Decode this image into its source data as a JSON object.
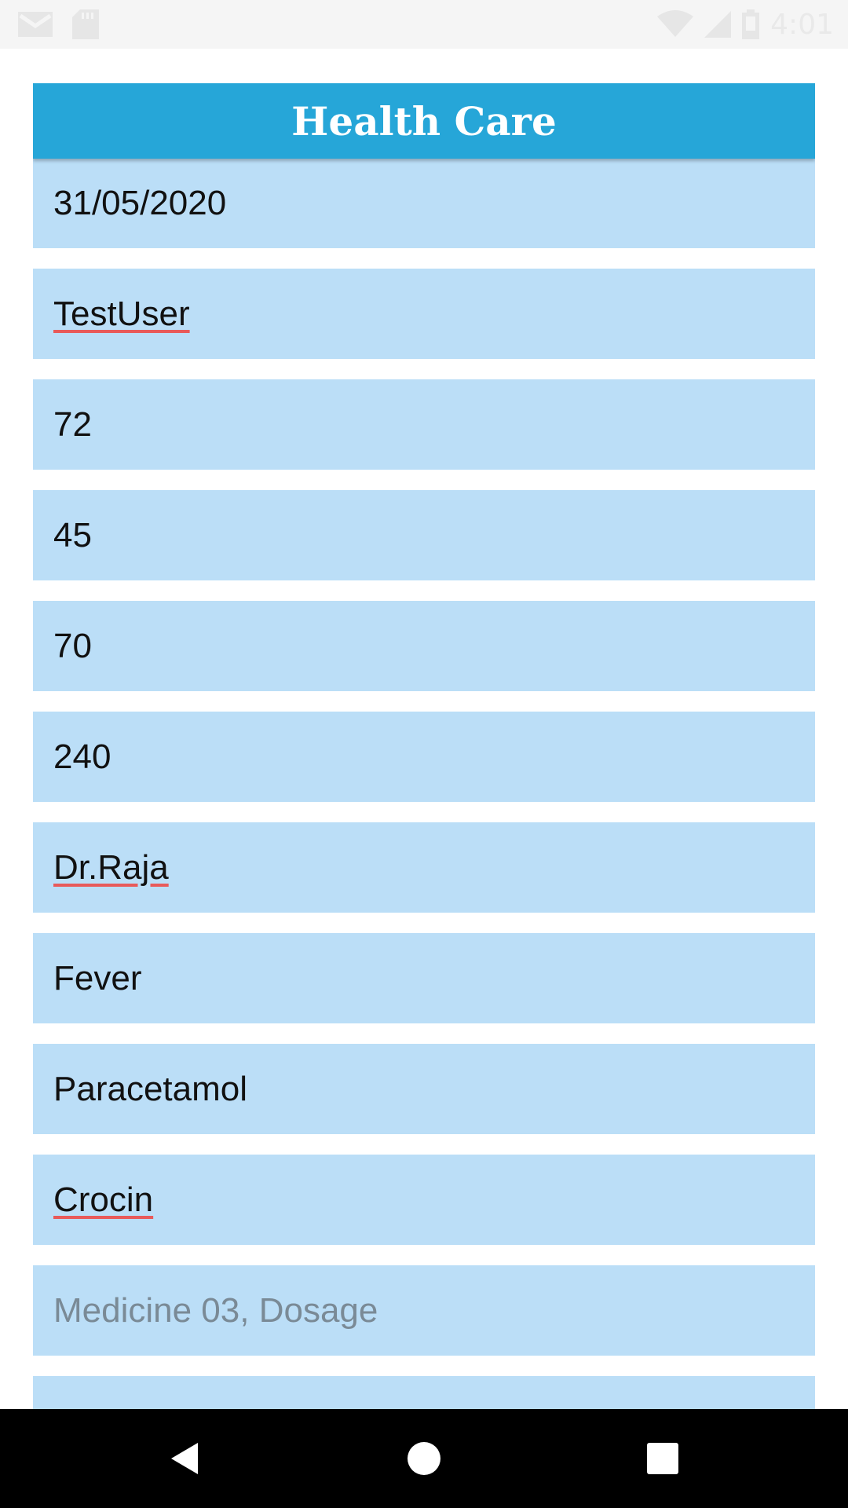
{
  "status_bar": {
    "time": "4:01",
    "icons": [
      "gmail-icon",
      "sd-card-icon",
      "wifi-icon",
      "cell-signal-icon",
      "battery-icon"
    ]
  },
  "header": {
    "title": "Health Care",
    "color": "#26a6d8"
  },
  "form": {
    "field_color": "#bbdef7",
    "fields": [
      {
        "value": "31/05/2020",
        "style": "normal"
      },
      {
        "value": "TestUser",
        "style": "spell"
      },
      {
        "value": "72",
        "style": "normal"
      },
      {
        "value": "45",
        "style": "normal"
      },
      {
        "value": "70",
        "style": "normal"
      },
      {
        "value": "240",
        "style": "normal"
      },
      {
        "value": "Dr.Raja",
        "style": "spell"
      },
      {
        "value": "Fever",
        "style": "normal"
      },
      {
        "value": "Paracetamol",
        "style": "normal"
      },
      {
        "value": "Crocin",
        "style": "spell"
      },
      {
        "placeholder": "Medicine 03, Dosage",
        "style": "placeholder"
      },
      {
        "value": "",
        "style": "normal"
      }
    ]
  },
  "nav_bar": {
    "icons": [
      "back-icon",
      "home-icon",
      "recents-icon"
    ]
  }
}
